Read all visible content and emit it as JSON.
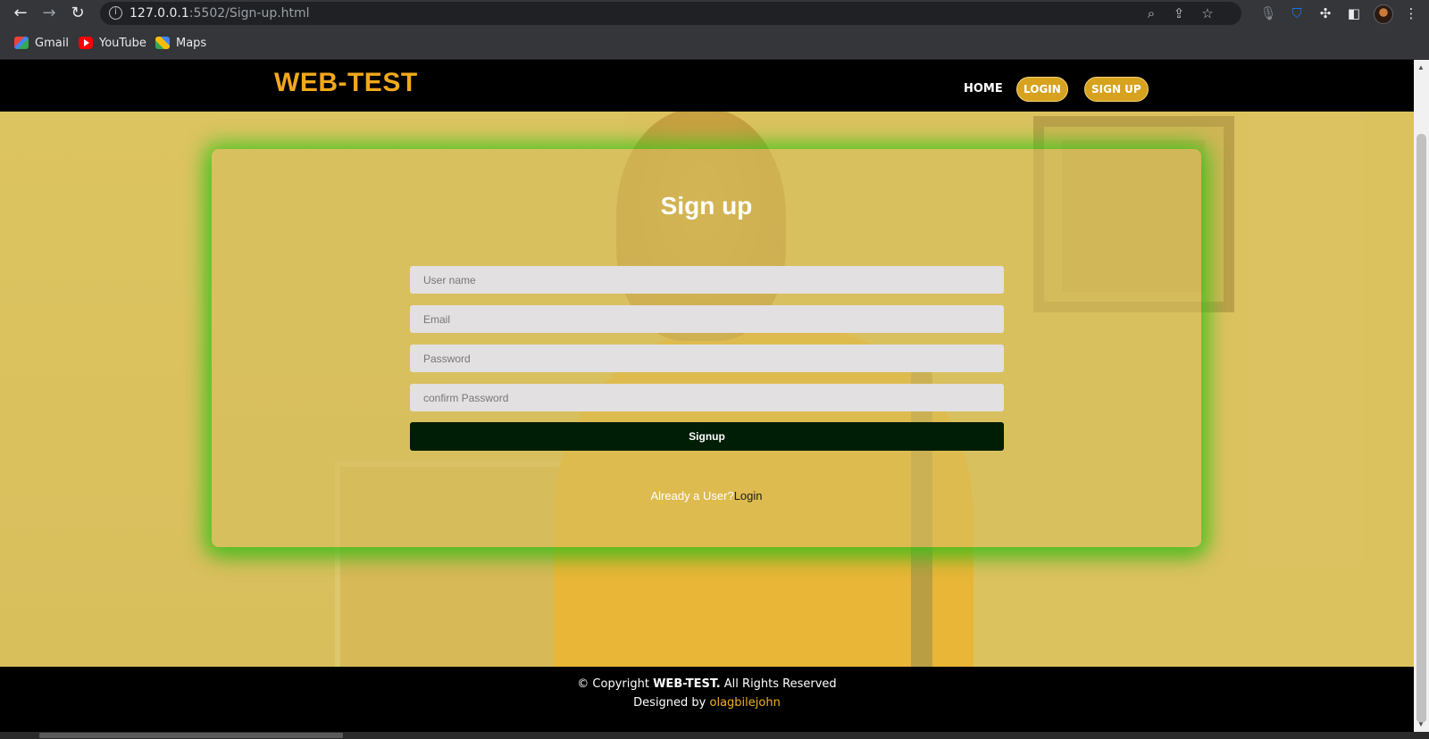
{
  "browser": {
    "url_host": "127.0.0.1",
    "url_rest": ":5502/Sign-up.html",
    "bookmarks": [
      {
        "label": "Gmail",
        "icon": "gmail-icon"
      },
      {
        "label": "YouTube",
        "icon": "youtube-icon"
      },
      {
        "label": "Maps",
        "icon": "maps-icon"
      }
    ]
  },
  "header": {
    "logo": "WEB-TEST",
    "nav": {
      "home": "HOME",
      "login": "LOGIN",
      "signup": "SIGN UP"
    }
  },
  "form": {
    "title": "Sign up",
    "fields": {
      "username_placeholder": "User name",
      "email_placeholder": "Email",
      "password_placeholder": "Password",
      "confirm_placeholder": "confirm Password"
    },
    "submit_label": "Signup",
    "already_text": "Already a User?",
    "login_link": "Login"
  },
  "footer": {
    "copyright_prefix": "© Copyright ",
    "brand": "WEB-TEST.",
    "copyright_suffix": " All Rights Reserved",
    "designed_by": "Designed by ",
    "designer": "olagbilejohn"
  },
  "colors": {
    "brand": "#f2a81c",
    "button_pill": "#d7a21e",
    "signup_button": "#001d06",
    "card_glow": "#3cc81e"
  }
}
